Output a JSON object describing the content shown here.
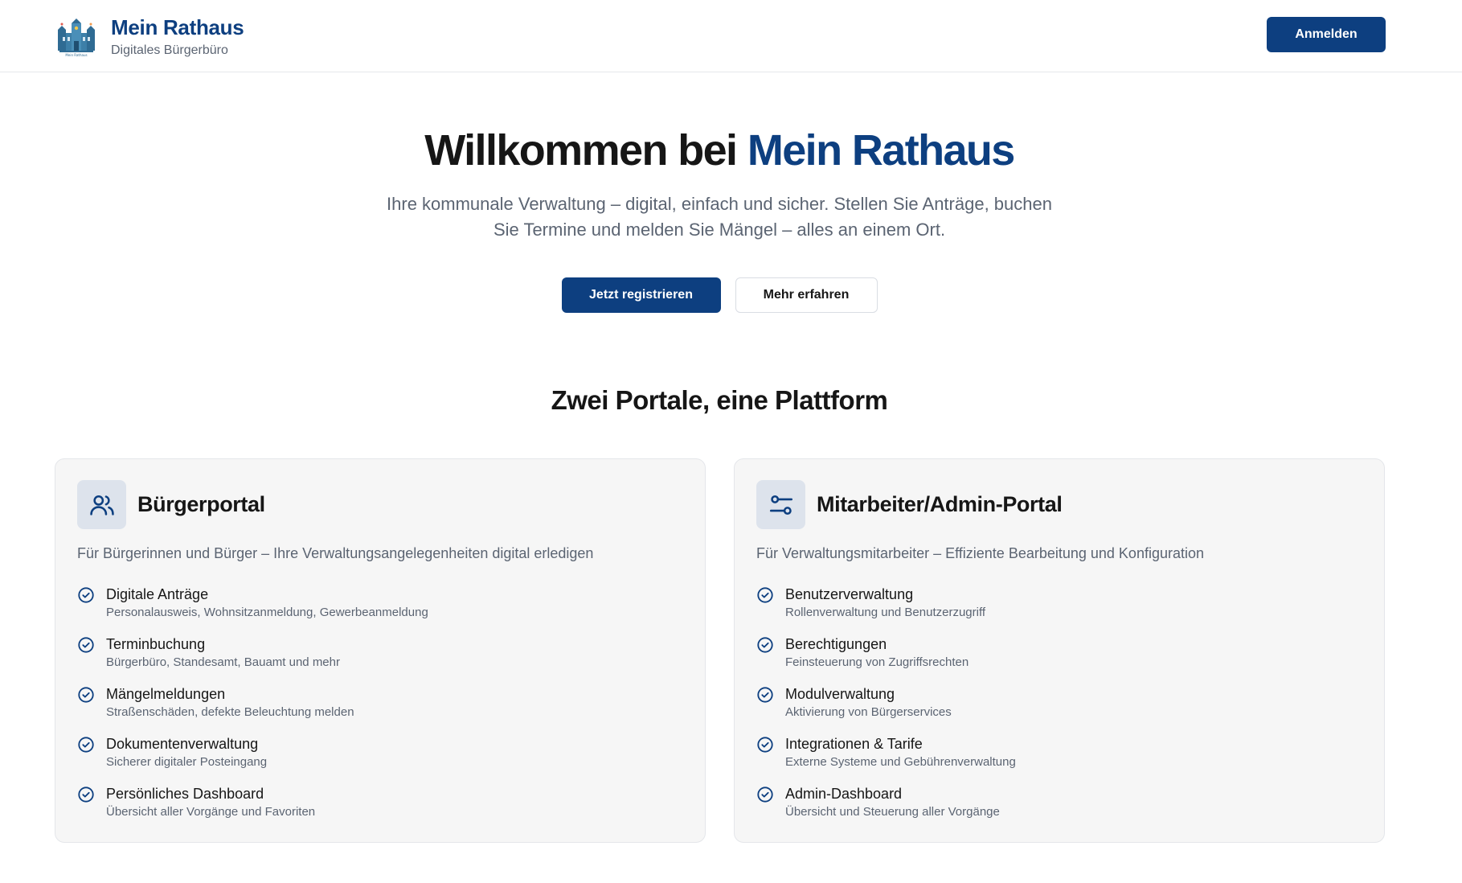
{
  "header": {
    "brand_title": "Mein Rathaus",
    "brand_subtitle": "Digitales Bürgerbüro",
    "logo_caption": "Mein Rathaus",
    "login_label": "Anmelden"
  },
  "hero": {
    "title_prefix": "Willkommen bei ",
    "title_accent": "Mein Rathaus",
    "subtitle": "Ihre kommunale Verwaltung – digital, einfach und sicher. Stellen Sie Anträge, buchen Sie Termine und melden Sie Mängel – alles an einem Ort.",
    "primary_label": "Jetzt registrieren",
    "secondary_label": "Mehr erfahren"
  },
  "section": {
    "title": "Zwei Portale, eine Plattform"
  },
  "portals": [
    {
      "icon": "users-icon",
      "title": "Bürgerportal",
      "description": "Für Bürgerinnen und Bürger – Ihre Verwaltungsangelegenheiten digital erledigen",
      "features": [
        {
          "title": "Digitale Anträge",
          "subtitle": "Personalausweis, Wohnsitzanmeldung, Gewerbeanmeldung"
        },
        {
          "title": "Terminbuchung",
          "subtitle": "Bürgerbüro, Standesamt, Bauamt und mehr"
        },
        {
          "title": "Mängelmeldungen",
          "subtitle": "Straßenschäden, defekte Beleuchtung melden"
        },
        {
          "title": "Dokumentenverwaltung",
          "subtitle": "Sicherer digitaler Posteingang"
        },
        {
          "title": "Persönliches Dashboard",
          "subtitle": "Übersicht aller Vorgänge und Favoriten"
        }
      ]
    },
    {
      "icon": "settings-toggle-icon",
      "title": "Mitarbeiter/Admin-Portal",
      "description": "Für Verwaltungsmitarbeiter – Effiziente Bearbeitung und Konfiguration",
      "features": [
        {
          "title": "Benutzerverwaltung",
          "subtitle": "Rollenverwaltung und Benutzerzugriff"
        },
        {
          "title": "Berechtigungen",
          "subtitle": "Feinsteuerung von Zugriffsrechten"
        },
        {
          "title": "Modulverwaltung",
          "subtitle": "Aktivierung von Bürgerservices"
        },
        {
          "title": "Integrationen & Tarife",
          "subtitle": "Externe Systeme und Gebührenverwaltung"
        },
        {
          "title": "Admin-Dashboard",
          "subtitle": "Übersicht und Steuerung aller Vorgänge"
        }
      ]
    }
  ],
  "colors": {
    "brand": "#0d3f80",
    "muted_text": "#5b6472",
    "card_bg": "#f6f6f6",
    "icon_bg": "#dde3ec"
  }
}
